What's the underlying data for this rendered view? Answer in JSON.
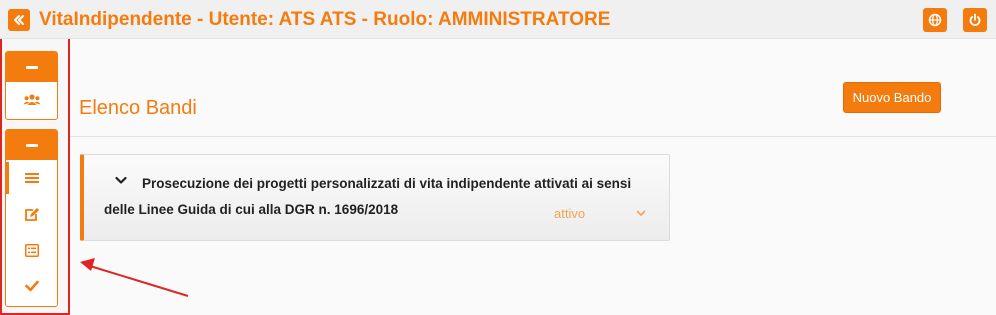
{
  "header": {
    "title": "VitaIndipendente - Utente: ATS ATS - Ruolo: AMMINISTRATORE",
    "back_icon": "double-chevron-left-icon",
    "globe_icon": "globe-icon",
    "power_icon": "power-icon"
  },
  "sidebar": {
    "groups": [
      {
        "header_icon": "minus-icon",
        "items": [
          {
            "icon": "users-icon"
          }
        ]
      },
      {
        "header_icon": "minus-icon",
        "items": [
          {
            "icon": "list-icon",
            "active": true
          },
          {
            "icon": "edit-icon"
          },
          {
            "icon": "list-alt-icon"
          },
          {
            "icon": "check-icon"
          }
        ]
      }
    ]
  },
  "main": {
    "page_title": "Elenco Bandi",
    "new_button_label": "Nuovo Bando",
    "bando": {
      "title": "Prosecuzione dei progetti personalizzati di vita indipendente attivati ai sensi delle Linee Guida di cui alla DGR n. 1696/2018",
      "status": "attivo"
    }
  },
  "colors": {
    "accent": "#f47c0f",
    "annotation_red": "#e02424",
    "status_text": "#f6a251"
  }
}
